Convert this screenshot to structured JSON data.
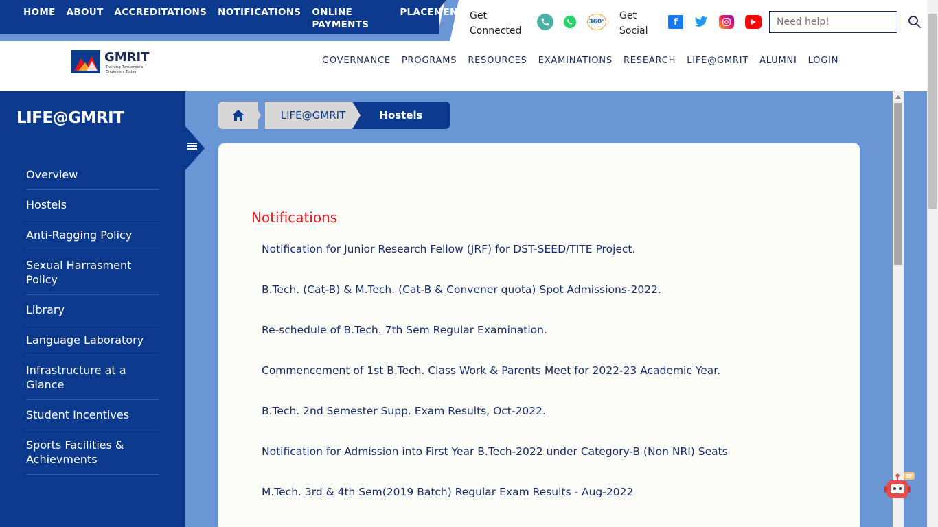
{
  "top_nav": [
    {
      "label": "HOME"
    },
    {
      "label": "ABOUT"
    },
    {
      "label": "ACCREDITATIONS"
    },
    {
      "label": "NOTIFICATIONS"
    },
    {
      "label": "ONLINE PAYMENTS"
    },
    {
      "label": "PLACEMENTS"
    }
  ],
  "connect": {
    "line1": "Get",
    "line2": "Connected",
    "icons": [
      "phone-icon",
      "whatsapp-icon",
      "360-view-icon"
    ]
  },
  "social": {
    "line1": "Get",
    "line2": "Social",
    "icons": [
      "facebook-icon",
      "twitter-icon",
      "instagram-icon",
      "youtube-icon"
    ]
  },
  "help": {
    "placeholder": "Need help!"
  },
  "logo": {
    "name": "GMRIT",
    "tagline_1": "Training Tomorrow's",
    "tagline_2": "Engineers Today"
  },
  "main_nav": [
    "GOVERNANCE",
    "PROGRAMS",
    "RESOURCES",
    "EXAMINATIONS",
    "RESEARCH",
    "LIFE@GMRIT",
    "ALUMNI",
    "LOGIN"
  ],
  "sidebar": {
    "title": "LIFE@GMRIT",
    "items": [
      "Overview",
      "Hostels",
      "Anti-Ragging Policy",
      "Sexual Harrasment Policy",
      "Library",
      "Language Laboratory",
      "Infrastructure at a Glance",
      "Student Incentives",
      "Sports Facilities & Achievments"
    ]
  },
  "breadcrumb": {
    "section": "LIFE@GMRIT",
    "current": "Hostels"
  },
  "notifications": {
    "title": "Notifications",
    "items": [
      "Notification for Junior Research Fellow (JRF) for DST-SEED/TITE Project.",
      "B.Tech. (Cat-B) & M.Tech. (Cat-B & Convener quota) Spot Admissions-2022.",
      "Re-schedule of B.Tech. 7th Sem Regular Examination.",
      "Commencement of 1st B.Tech. Class Work & Parents Meet for 2022-23 Academic Year.",
      "B.Tech. 2nd Semester Supp. Exam Results, Oct-2022.",
      "Notification for Admission into First Year B.Tech-2022 under Category-B (Non NRI) Seats",
      "M.Tech. 3rd & 4th Sem(2019 Batch) Regular Exam Results - Aug-2022"
    ]
  },
  "colors": {
    "primary": "#0b3a8c",
    "accent_light": "#6b96d6",
    "notification_title": "#e8141b"
  }
}
